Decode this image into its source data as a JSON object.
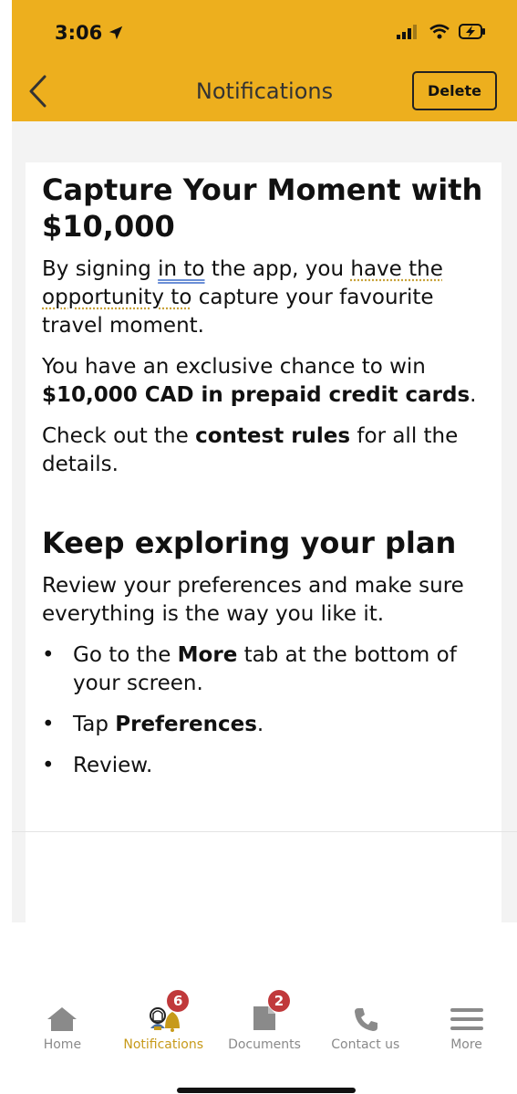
{
  "status": {
    "time": "3:06"
  },
  "nav": {
    "title": "Notifications",
    "delete_label": "Delete"
  },
  "notification1": {
    "title": "Capture Your Moment with $10,000",
    "p1": {
      "pre": "By signing ",
      "in_to": "in to",
      "mid": " the app, you ",
      "have_the": "have the",
      "space": " ",
      "opportunity_to": "opportunity to",
      "post": " capture your favourite travel moment."
    },
    "p2": {
      "pre": "You have an exclusive chance to win ",
      "bold": "$10,000 CAD in prepaid credit cards",
      "post": "."
    },
    "p3": {
      "pre": "Check out the ",
      "bold": "contest rules",
      "post": " for all the details."
    }
  },
  "notification2": {
    "title": "Keep exploring your plan",
    "intro": "Review your preferences and make sure everything is the way you like it.",
    "bullets": [
      {
        "pre": "Go to the ",
        "bold": "More",
        "post": " tab at the bottom of your screen."
      },
      {
        "pre": "Tap ",
        "bold": "Preferences",
        "post": "."
      },
      {
        "pre": "Review.",
        "bold": "",
        "post": ""
      }
    ]
  },
  "tabs": [
    {
      "label": "Home",
      "icon": "home-icon",
      "badge": ""
    },
    {
      "label": "Notifications",
      "icon": "bell-icon",
      "badge": "6"
    },
    {
      "label": "Documents",
      "icon": "document-icon",
      "badge": "2"
    },
    {
      "label": "Contact us",
      "icon": "phone-icon",
      "badge": ""
    },
    {
      "label": "More",
      "icon": "menu-icon",
      "badge": ""
    }
  ],
  "colors": {
    "header": "#EDAF1E",
    "active_tab": "#C79A1A",
    "badge": "#C0393B",
    "inactive_tab": "#8a8a8a"
  }
}
